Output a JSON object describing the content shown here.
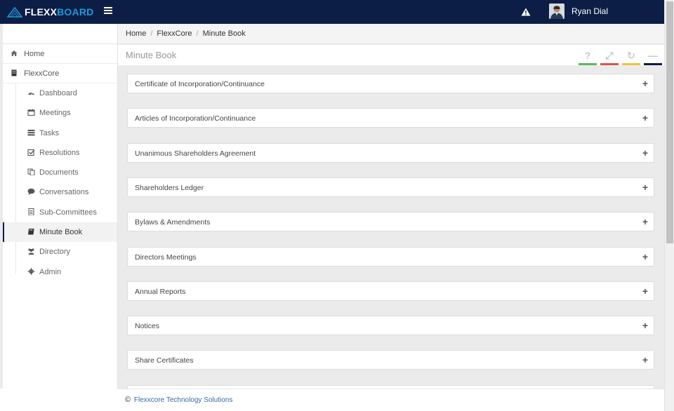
{
  "brand": {
    "part1": "FLEXX",
    "part2": "BOARD"
  },
  "user": {
    "name": "Ryan Dial"
  },
  "breadcrumb": [
    "Home",
    "FlexxCore",
    "Minute Book"
  ],
  "breadcrumb_sep": "/",
  "sidebar": {
    "home": "Home",
    "org": "FlexxCore",
    "items": [
      {
        "label": "Dashboard",
        "icon": "dashboard-icon"
      },
      {
        "label": "Meetings",
        "icon": "calendar-icon"
      },
      {
        "label": "Tasks",
        "icon": "tasks-icon"
      },
      {
        "label": "Resolutions",
        "icon": "check-square-icon"
      },
      {
        "label": "Documents",
        "icon": "documents-icon"
      },
      {
        "label": "Conversations",
        "icon": "comment-icon"
      },
      {
        "label": "Sub-Committees",
        "icon": "file-icon"
      },
      {
        "label": "Minute Book",
        "icon": "book-icon",
        "active": true
      },
      {
        "label": "Directory",
        "icon": "users-icon"
      },
      {
        "label": "Admin",
        "icon": "gear-icon"
      }
    ]
  },
  "panel": {
    "title": "Minute Book",
    "tools": [
      {
        "name": "help-icon",
        "glyph": "?",
        "color": "#5cb85c"
      },
      {
        "name": "expand-icon",
        "glyph": "⤢",
        "color": "#d9534f"
      },
      {
        "name": "refresh-icon",
        "glyph": "↻",
        "color": "#f0c23b"
      },
      {
        "name": "collapse-icon",
        "glyph": "—",
        "color": "#0c1e45"
      }
    ]
  },
  "sections": [
    "Certificate of Incorporation/Continuance",
    "Articles of Incorporation/Continuance",
    "Unanimous Shareholders Agreement",
    "Shareholders Ledger",
    "Bylaws & Amendments",
    "Directors Meetings",
    "Annual Reports",
    "Notices",
    "Share Certificates",
    ""
  ],
  "expand_glyph": "+",
  "footer": {
    "copyright_symbol": "©",
    "text": "Flexxcore Technology Solutions"
  }
}
